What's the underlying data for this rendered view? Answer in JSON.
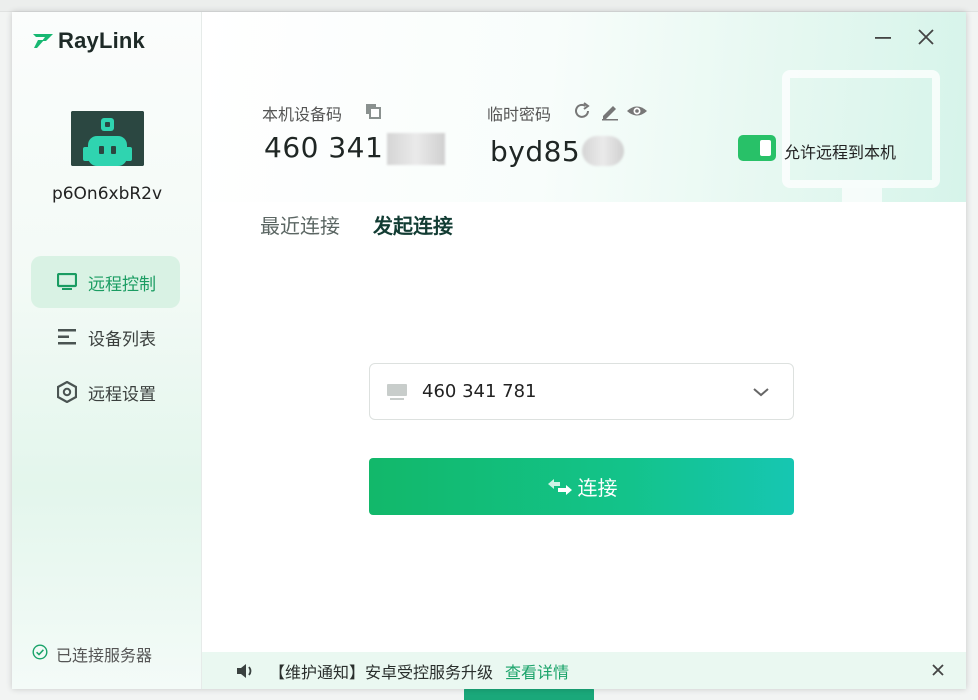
{
  "app": {
    "brand": "RayLink"
  },
  "sidebar": {
    "device_name": "p6On6xbR2v",
    "nav": [
      {
        "label": "远程控制",
        "icon": "monitor-icon",
        "active": true
      },
      {
        "label": "设备列表",
        "icon": "list-icon",
        "active": false
      },
      {
        "label": "远程设置",
        "icon": "settings-hexagon-icon",
        "active": false
      }
    ],
    "server_status": "已连接服务器"
  },
  "header": {
    "device_code_label": "本机设备码",
    "device_code": "460 341",
    "temp_password_label": "临时密码",
    "temp_password": "byd85",
    "allow_remote_label": "允许远程到本机",
    "allow_remote_on": true
  },
  "tabs": [
    {
      "label": "最近连接",
      "active": false
    },
    {
      "label": "发起连接",
      "active": true
    }
  ],
  "connect": {
    "device_value": "460 341 781",
    "button_label": "连接"
  },
  "notice": {
    "text": "【维护通知】安卓受控服务升级",
    "link": "查看详情"
  },
  "colors": {
    "accent": "#1a9c62",
    "toggle": "#28c168",
    "button_start": "#12b86a",
    "button_end": "#16c6b2"
  }
}
